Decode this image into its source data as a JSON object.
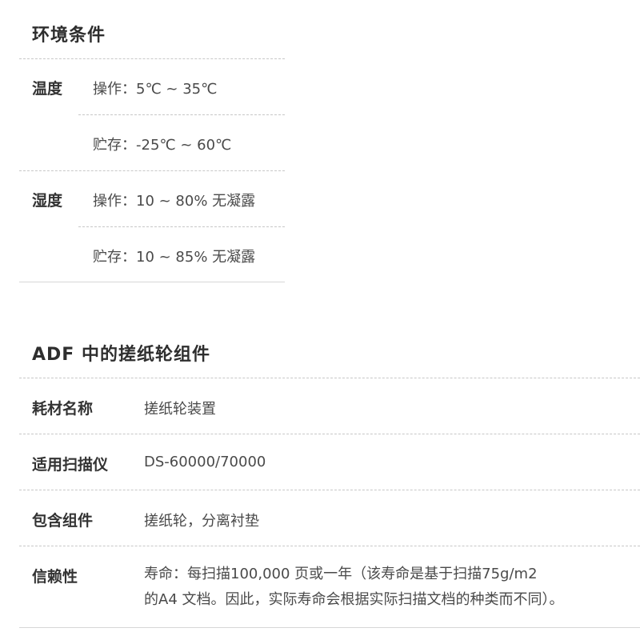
{
  "env": {
    "title": "环境条件",
    "temperature": {
      "label": "温度",
      "operating": "操作：5℃ ~ 35℃",
      "storage": "贮存：-25℃ ~ 60℃"
    },
    "humidity": {
      "label": "湿度",
      "operating": "操作：10 ~ 80% 无凝露",
      "storage": "贮存：10 ~ 85% 无凝露"
    }
  },
  "adf": {
    "title": "ADF 中的搓纸轮组件",
    "rows": [
      {
        "label": "耗材名称",
        "value": "搓纸轮装置"
      },
      {
        "label": "适用扫描仪",
        "value": "DS-60000/70000"
      },
      {
        "label": "包含组件",
        "value": "搓纸轮，分离衬垫"
      },
      {
        "label": "信赖性",
        "value_line1": "寿命：每扫描100,000 页或一年（该寿命是基于扫描75g/m2",
        "value_line2": "的A4 文档。因此，实际寿命会根据实际扫描文档的种类而不同）。"
      }
    ]
  }
}
